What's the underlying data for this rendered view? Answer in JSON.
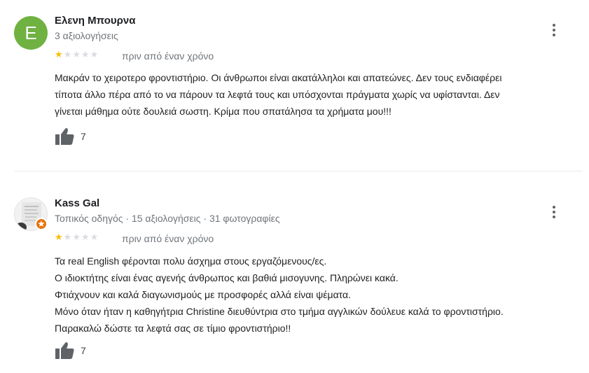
{
  "reviews": [
    {
      "avatar_letter": "E",
      "avatar_color": "#6fb242",
      "name": "Ελενη Μπουρνα",
      "meta": "3 αξιολογήσεις",
      "rating": 1,
      "date": "πριν από έναν χρόνο",
      "text_lines": [
        "Μακράν το χειροτερο φροντιστήριο. Οι άνθρωποι είναι ακατάλληλοι και απατεώνες. Δεν τους ενδιαφέρει",
        "τίποτα άλλο πέρα από το να πάρουν τα λεφτά τους και υπόσχονται πράγματα χωρίς να υφίστανται. Δεν",
        "γίνεται μάθημα ούτε δουλειά σωστη. Κρίμα που σπατάλησα τα χρήματα μου!!!"
      ],
      "likes": "7"
    },
    {
      "name": "Kass Gal",
      "meta": "Τοπικός οδηγός · 15 αξιολογήσεις · 31 φωτογραφίες",
      "rating": 1,
      "date": "πριν από έναν χρόνο",
      "text_lines": [
        "Τα real English φέρονται πολυ άσχημα στους εργαζόμενους/ες.",
        "Ο ιδιοκτήτης είναι ένας αγενής άνθρωπος και βαθιά μισογυνης. Πληρώνει κακά.",
        "Φτιάχνουν και καλά διαγωνισμούς με προσφορές αλλά είναι ψέματα.",
        "Μόνο όταν ήταν η καθηγήτρια Christine διευθύντρια στο τμήμα αγγλικών δούλευε καλά το φροντιστήριο.",
        "Παρακαλώ δώστε τα λεφτά σας σε τίμιο φροντιστήριο!!"
      ],
      "likes": "7"
    }
  ],
  "colors": {
    "star_on": "#fbbc04",
    "star_off": "#dadce0",
    "local_guide_badge": "#e8710a"
  },
  "icons": {
    "more": "more-vert-icon",
    "like": "thumbs-up-icon",
    "star": "star-icon"
  }
}
